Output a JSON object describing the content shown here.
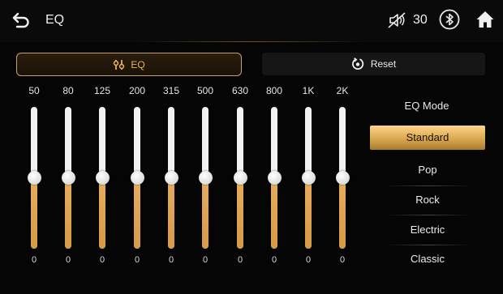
{
  "header": {
    "title": "EQ",
    "volume": "30"
  },
  "tabs": {
    "eq_label": "EQ",
    "reset_label": "Reset"
  },
  "bands": [
    {
      "freq": "50",
      "gain": "0",
      "level": 0.5
    },
    {
      "freq": "80",
      "gain": "0",
      "level": 0.5
    },
    {
      "freq": "125",
      "gain": "0",
      "level": 0.5
    },
    {
      "freq": "200",
      "gain": "0",
      "level": 0.5
    },
    {
      "freq": "315",
      "gain": "0",
      "level": 0.5
    },
    {
      "freq": "500",
      "gain": "0",
      "level": 0.5
    },
    {
      "freq": "630",
      "gain": "0",
      "level": 0.5
    },
    {
      "freq": "800",
      "gain": "0",
      "level": 0.5
    },
    {
      "freq": "1K",
      "gain": "0",
      "level": 0.5
    },
    {
      "freq": "2K",
      "gain": "0",
      "level": 0.5
    }
  ],
  "eq_mode": {
    "title": "EQ Mode",
    "selected": "Standard",
    "options": [
      "Standard",
      "Pop",
      "Rock",
      "Electric",
      "Classic"
    ]
  },
  "colors": {
    "accent": "#e6ad5f",
    "background": "#050505",
    "track": "#f2f2f2"
  },
  "icons": [
    "back-arrow-icon",
    "volume-mute-icon",
    "bluetooth-icon",
    "home-icon",
    "equalizer-icon",
    "reset-icon"
  ]
}
